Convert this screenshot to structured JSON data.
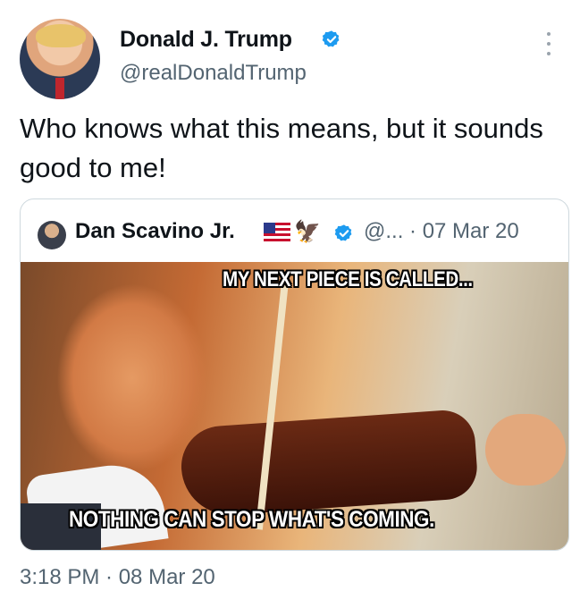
{
  "author": {
    "name": "Donald J. Trump",
    "handle": "@realDonaldTrump",
    "verified_icon": "verified-badge-icon"
  },
  "tweet": {
    "text": "Who knows what this means, but it sounds good to me!",
    "timestamp": "3:18 PM · 08 Mar 20"
  },
  "quoted": {
    "name": "Dan Scavino Jr.",
    "emoji": "🦅",
    "meta": "@... · 07 Mar 20",
    "meme_top": "MY NEXT PIECE IS CALLED...",
    "meme_bottom": "NOTHING CAN STOP WHAT'S COMING."
  },
  "colors": {
    "verified": "#1d9bf0",
    "muted": "#536471",
    "border": "#cfd9de"
  }
}
